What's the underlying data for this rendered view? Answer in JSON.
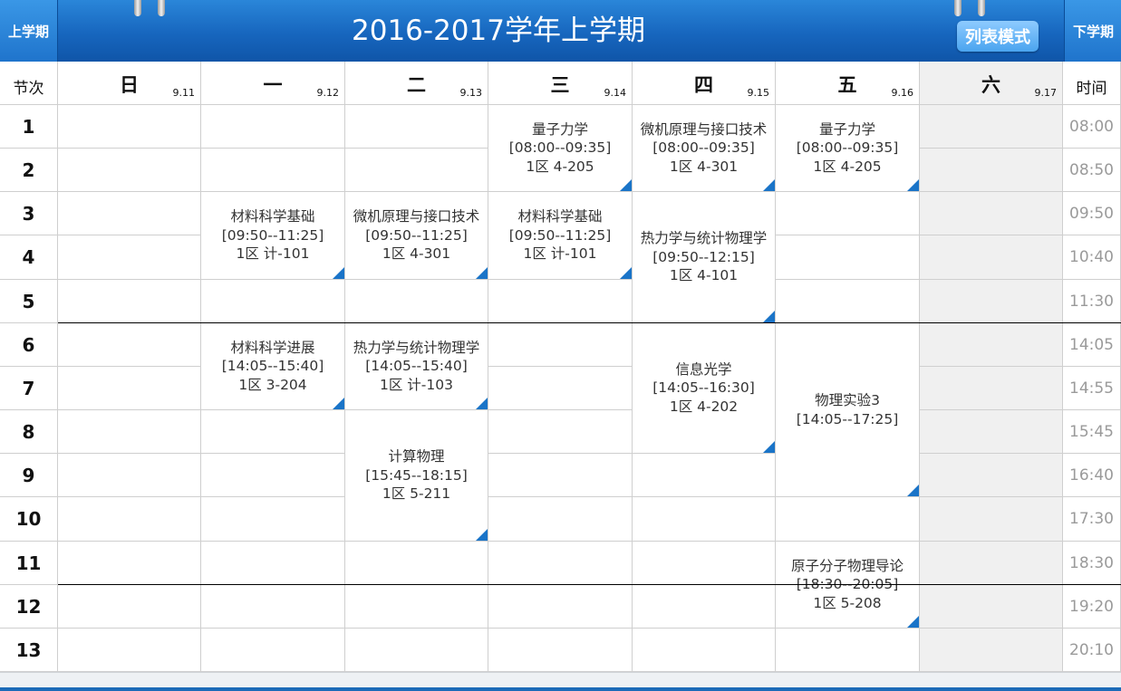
{
  "header": {
    "title": "2016-2017学年上学期",
    "prev_semester": "上学期",
    "next_semester": "下学期",
    "mode_button": "列表模式"
  },
  "table": {
    "corner_label": "节次",
    "time_label": "时间",
    "days": [
      {
        "name": "日",
        "date": "9.11"
      },
      {
        "name": "一",
        "date": "9.12"
      },
      {
        "name": "二",
        "date": "9.13"
      },
      {
        "name": "三",
        "date": "9.14"
      },
      {
        "name": "四",
        "date": "9.15"
      },
      {
        "name": "五",
        "date": "9.16"
      },
      {
        "name": "六",
        "date": "9.17"
      }
    ],
    "periods": [
      {
        "num": "1",
        "time": "08:00"
      },
      {
        "num": "2",
        "time": "08:50"
      },
      {
        "num": "3",
        "time": "09:50"
      },
      {
        "num": "4",
        "time": "10:40"
      },
      {
        "num": "5",
        "time": "11:30"
      },
      {
        "num": "6",
        "time": "14:05"
      },
      {
        "num": "7",
        "time": "14:55"
      },
      {
        "num": "8",
        "time": "15:45"
      },
      {
        "num": "9",
        "time": "16:40"
      },
      {
        "num": "10",
        "time": "17:30"
      },
      {
        "num": "11",
        "time": "18:30"
      },
      {
        "num": "12",
        "time": "19:20"
      },
      {
        "num": "13",
        "time": "20:10"
      }
    ]
  },
  "courses": [
    {
      "day": 3,
      "start": 1,
      "end": 2,
      "name": "量子力学",
      "time": "[08:00--09:35]",
      "room": "1区 4-205"
    },
    {
      "day": 4,
      "start": 1,
      "end": 2,
      "name": "微机原理与接口技术",
      "time": "[08:00--09:35]",
      "room": "1区 4-301"
    },
    {
      "day": 5,
      "start": 1,
      "end": 2,
      "name": "量子力学",
      "time": "[08:00--09:35]",
      "room": "1区 4-205"
    },
    {
      "day": 1,
      "start": 3,
      "end": 4,
      "name": "材料科学基础",
      "time": "[09:50--11:25]",
      "room": "1区 计-101"
    },
    {
      "day": 2,
      "start": 3,
      "end": 4,
      "name": "微机原理与接口技术",
      "time": "[09:50--11:25]",
      "room": "1区 4-301"
    },
    {
      "day": 3,
      "start": 3,
      "end": 4,
      "name": "材料科学基础",
      "time": "[09:50--11:25]",
      "room": "1区 计-101"
    },
    {
      "day": 4,
      "start": 3,
      "end": 5,
      "name": "热力学与统计物理学",
      "time": "[09:50--12:15]",
      "room": "1区 4-101"
    },
    {
      "day": 1,
      "start": 6,
      "end": 7,
      "name": "材料科学进展",
      "time": "[14:05--15:40]",
      "room": "1区 3-204"
    },
    {
      "day": 2,
      "start": 6,
      "end": 7,
      "name": "热力学与统计物理学",
      "time": "[14:05--15:40]",
      "room": "1区 计-103"
    },
    {
      "day": 4,
      "start": 6,
      "end": 8,
      "name": "信息光学",
      "time": "[14:05--16:30]",
      "room": "1区 4-202"
    },
    {
      "day": 5,
      "start": 6,
      "end": 9,
      "name": "物理实验3",
      "time": "[14:05--17:25]",
      "room": ""
    },
    {
      "day": 2,
      "start": 8,
      "end": 10,
      "name": "计算物理",
      "time": "[15:45--18:15]",
      "room": "1区 5-211"
    },
    {
      "day": 5,
      "start": 11,
      "end": 12,
      "name": "原子分子物理导论",
      "time": "[18:30--20:05]",
      "room": "1区 5-208"
    }
  ],
  "colors": {
    "header_blue": "#1766be",
    "corner_marker": "#1a74c8",
    "saturday_bg": "#f0f0f0",
    "time_text": "#9a9a9a"
  }
}
